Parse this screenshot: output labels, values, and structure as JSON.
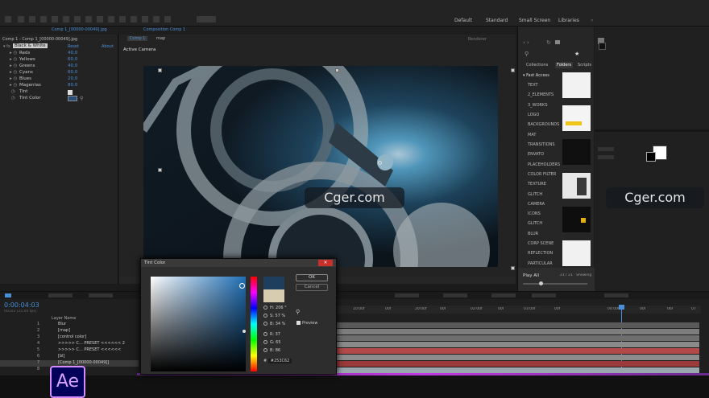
{
  "workspace": {
    "tabs": [
      "Default",
      "Standard",
      "Small Screen",
      "Libraries"
    ]
  },
  "effects_panel": {
    "tab": "Comp 1",
    "file": "Comp 1_[00000-00049].jpg",
    "layer_title": "Comp 1 - Comp 1_[00000-00049].jpg",
    "effect_name": "Black & White",
    "reset": "Reset",
    "about": "About",
    "rows": [
      {
        "label": "Reds",
        "value": "40.0"
      },
      {
        "label": "Yellows",
        "value": "60.0"
      },
      {
        "label": "Greens",
        "value": "40.0"
      },
      {
        "label": "Cyans",
        "value": "60.0"
      },
      {
        "label": "Blues",
        "value": "20.0"
      },
      {
        "label": "Magentas",
        "value": "80.0"
      },
      {
        "label": "Tint",
        "value": ""
      },
      {
        "label": "Tint Color",
        "value": ""
      }
    ]
  },
  "viewer": {
    "tab_label": "Composition Comp 1",
    "sub_tabs": [
      "Comp 1",
      "map"
    ],
    "view_label": "Active Camera",
    "renderer": "Renderer"
  },
  "project": {
    "tabs": [
      "Collections",
      "Folders",
      "Scripts"
    ],
    "quick_access": "Fast Access",
    "folders": [
      "TEXT",
      "2_ELEMENTS",
      "3_WORKS",
      "LOGO",
      "BACKGROUNDS",
      "MAT",
      "TRANSITIONS",
      "ENVATO",
      "PLACEHOLDERS",
      "COLOR FILTER",
      "TEXTURE",
      "GLITCH",
      "CAMERA",
      "ICONS",
      "GLITCH",
      "BLUR",
      "CORP SCENE",
      "REFLECTION",
      "PARTICULAR"
    ],
    "play_all": "Play All",
    "count": "21 / 21 · Showing"
  },
  "timeline": {
    "timecode": "0:00:04:03",
    "fps": "00103 (25.00 fps)",
    "column_header": "Layer Name",
    "layers": [
      {
        "num": "1",
        "name": "Blur"
      },
      {
        "num": "2",
        "name": "[map]"
      },
      {
        "num": "3",
        "name": "[control color]"
      },
      {
        "num": "4",
        "name": ">>>>> C... PRESET <<<<<< 2"
      },
      {
        "num": "5",
        "name": ">>>>> C... PRESET <<<<<<"
      },
      {
        "num": "6",
        "name": "[bl]"
      },
      {
        "num": "7",
        "name": "[Comp 1_[00000-00049]]"
      },
      {
        "num": "8",
        "name": ""
      }
    ],
    "ruler": [
      "10:00f",
      "00f",
      "20:00f",
      "00f",
      "02:00f",
      "00f",
      "03:00f",
      "00f",
      "04:00f",
      "00f",
      "06f",
      "07"
    ],
    "track_colors": [
      "#5a5a5a",
      "#7d7d7d",
      "#6e6e6e",
      "#8a8a8a",
      "#b24a4a",
      "#8c8c8c",
      "#9a3a3a",
      "#9aa8ad"
    ]
  },
  "color_dialog": {
    "title": "Tint Color",
    "ok": "OK",
    "cancel": "Cancel",
    "fields": [
      {
        "label": "H: 206 °"
      },
      {
        "label": "S: 57 %"
      },
      {
        "label": "B: 34 %"
      },
      {
        "label": "R: 37"
      },
      {
        "label": "G: 65"
      },
      {
        "label": "B: 86"
      }
    ],
    "preview": "Preview",
    "hex": "#253C62",
    "new_color": "#1f3d5c",
    "current_color": "#d8ccb0"
  },
  "watermarks": [
    "Cger.com",
    "Cger.com"
  ],
  "logo": "Ae"
}
